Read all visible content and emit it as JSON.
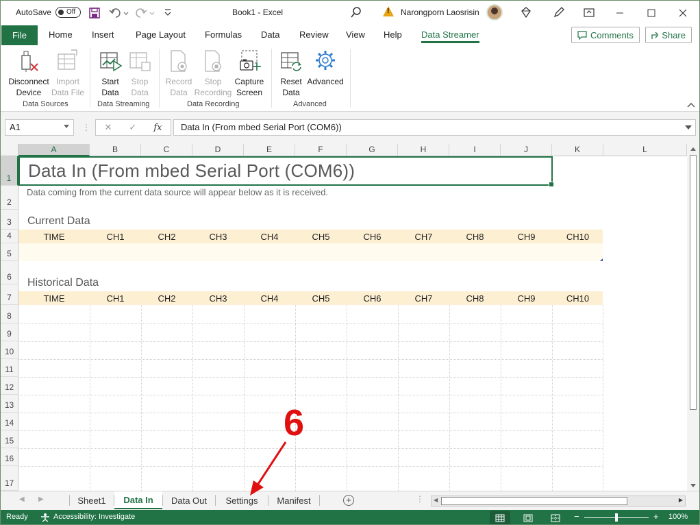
{
  "titlebar": {
    "autosave_label": "AutoSave",
    "autosave_state": "Off",
    "doc_title": "Book1  -  Excel",
    "user_name": "Narongporn Laosrisin"
  },
  "tabs": {
    "file": "File",
    "items": [
      "Home",
      "Insert",
      "Page Layout",
      "Formulas",
      "Data",
      "Review",
      "View",
      "Help",
      "Data Streamer"
    ],
    "active": "Data Streamer",
    "comments": "Comments",
    "share": "Share"
  },
  "ribbon": {
    "groups": {
      "data_sources": "Data Sources",
      "data_streaming": "Data Streaming",
      "data_recording": "Data Recording",
      "advanced": "Advanced"
    },
    "buttons": {
      "disconnect_1": "Disconnect",
      "disconnect_2": "Device",
      "import_1": "Import",
      "import_2": "Data File",
      "start_1": "Start",
      "start_2": "Data",
      "stop_1": "Stop",
      "stop_2": "Data",
      "record_1": "Record",
      "record_2": "Data",
      "stoprec_1": "Stop",
      "stoprec_2": "Recording",
      "capture_1": "Capture",
      "capture_2": "Screen",
      "reset_1": "Reset",
      "reset_2": "Data",
      "advanced": "Advanced"
    }
  },
  "formula_bar": {
    "name_box": "A1",
    "formula": "Data In (From mbed Serial Port (COM6))"
  },
  "grid": {
    "columns": [
      "A",
      "B",
      "C",
      "D",
      "E",
      "F",
      "G",
      "H",
      "I",
      "J",
      "K",
      "L"
    ],
    "rows": [
      "1",
      "2",
      "3",
      "4",
      "5",
      "6",
      "7",
      "8",
      "9",
      "10",
      "11",
      "12",
      "13",
      "14",
      "15",
      "16",
      "17"
    ],
    "title": "Data In (From mbed Serial Port (COM6))",
    "subtitle": "Data coming from the current data source will appear below as it is received.",
    "current_label": "Current Data",
    "historical_label": "Historical Data",
    "channel_headers": [
      "TIME",
      "CH1",
      "CH2",
      "CH3",
      "CH4",
      "CH5",
      "CH6",
      "CH7",
      "CH8",
      "CH9",
      "CH10"
    ]
  },
  "sheets": {
    "tabs": [
      "Sheet1",
      "Data In",
      "Data Out",
      "Settings",
      "Manifest"
    ],
    "active": "Data In"
  },
  "status": {
    "ready": "Ready",
    "accessibility": "Accessibility: Investigate",
    "zoom": "100%",
    "zoom_minus": "−",
    "zoom_plus": "+"
  },
  "annotation": {
    "number": "6"
  }
}
